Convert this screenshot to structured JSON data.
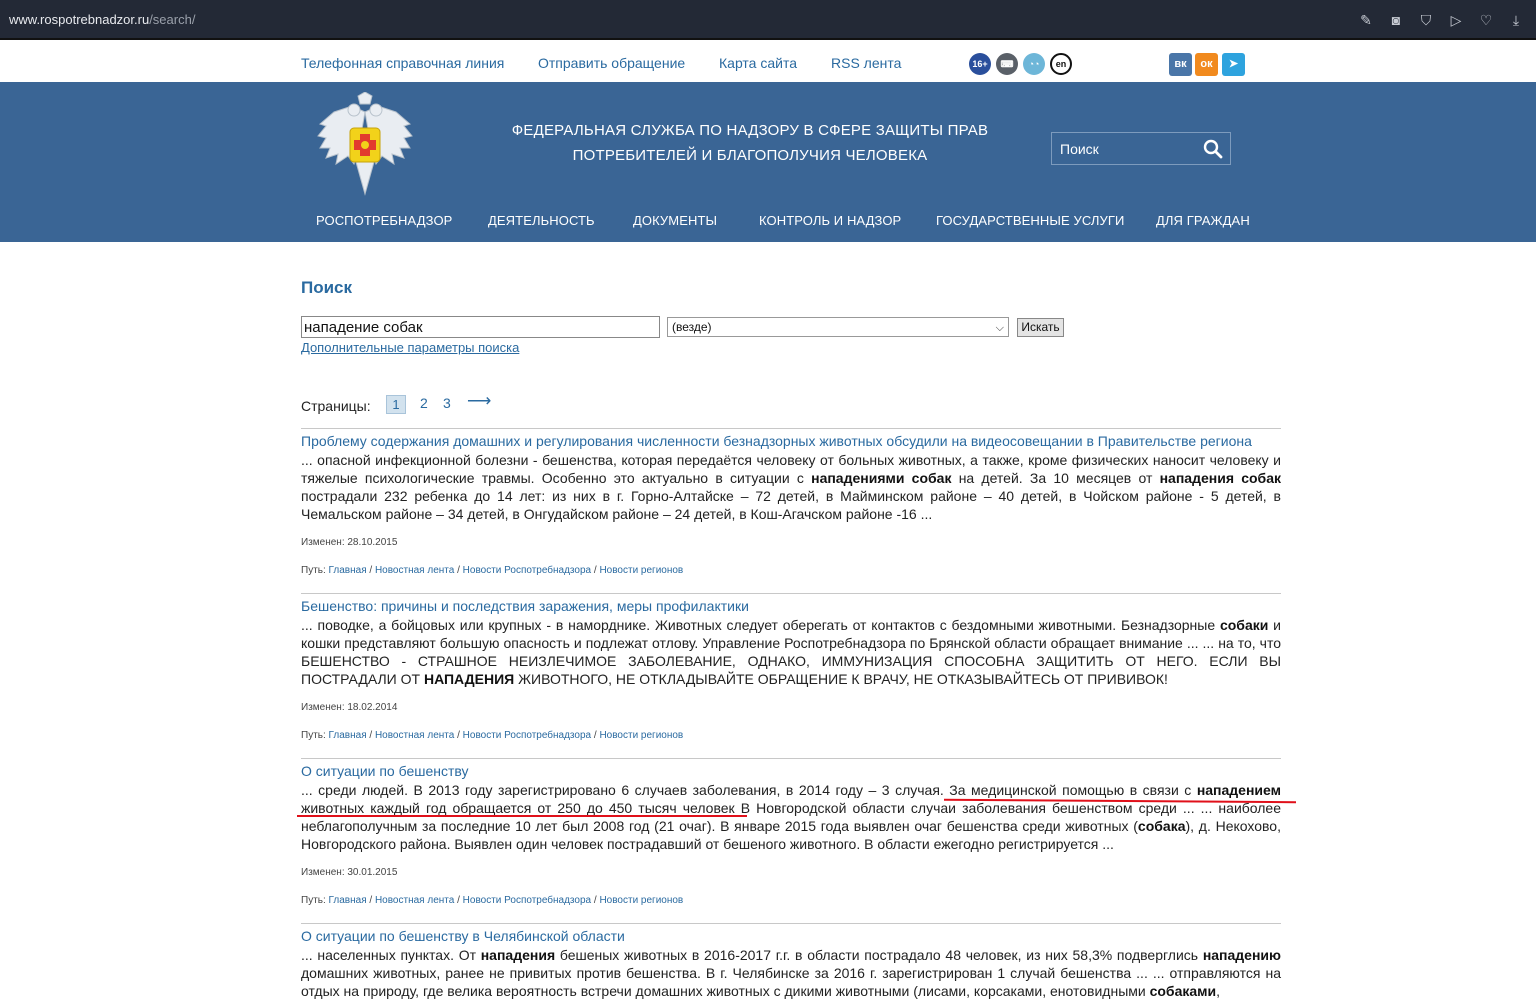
{
  "browser": {
    "url_host": "www.rospotrebnadzor.ru",
    "url_path": "/search/"
  },
  "toplinks": [
    "Телефонная справочная линия",
    "Отправить обращение",
    "Карта сайта",
    "RSS лента"
  ],
  "badges": {
    "age": "16+",
    "lang": "en"
  },
  "social": {
    "vk": "VK",
    "ok": "OK",
    "tg": "TG"
  },
  "header": {
    "agency_line1": "ФЕДЕРАЛЬНАЯ СЛУЖБА ПО НАДЗОРУ В СФЕРЕ ЗАЩИТЫ ПРАВ",
    "agency_line2": "ПОТРЕБИТЕЛЕЙ И БЛАГОПОЛУЧИЯ ЧЕЛОВЕКА",
    "search_placeholder": "Поиск"
  },
  "nav": [
    "РОСПОТРЕБНАДЗОР",
    "ДЕЯТЕЛЬНОСТЬ",
    "ДОКУМЕНТЫ",
    "КОНТРОЛЬ И НАДЗОР",
    "ГОСУДАРСТВЕННЫЕ УСЛУГИ",
    "ДЛЯ ГРАЖДАН"
  ],
  "search": {
    "title": "Поиск",
    "query": "нападение собак",
    "scope": "(везде)",
    "button": "Искать",
    "advanced": "Дополнительные параметры поиска"
  },
  "pager": {
    "label": "Страницы:",
    "pages": [
      "1",
      "2",
      "3"
    ],
    "next": "⟶"
  },
  "results": [
    {
      "title": "Проблему содержания домашних и регулирования численности безнадзорных животных обсудили на видеосовещании в Правительстве региона",
      "modified": "Изменен: 28.10.2015"
    },
    {
      "title": "Бешенство: причины и последствия заражения, меры профилактики",
      "modified": "Изменен: 18.02.2014"
    },
    {
      "title": "О ситуации по бешенству",
      "modified": "Изменен: 30.01.2015"
    },
    {
      "title": "О ситуации по бешенству в Челябинской области"
    }
  ],
  "path": {
    "label": "Путь:",
    "crumbs": [
      "Главная",
      "Новостная лента",
      "Новости Роспотребнадзора",
      "Новости регионов"
    ]
  },
  "colors": {
    "header_bg": "#3a6595",
    "link": "#2a6aa0",
    "annotation": "#e0101a"
  }
}
